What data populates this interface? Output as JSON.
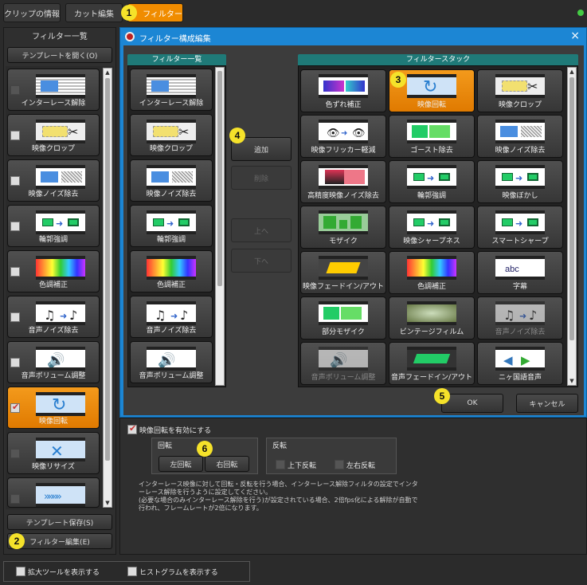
{
  "tabs": [
    "クリップの情報",
    "カット編集",
    "フィルター"
  ],
  "badges": [
    "1",
    "2",
    "3",
    "4",
    "5",
    "6"
  ],
  "left_panel": {
    "title": "フィルター一覧",
    "template_open": "テンプレートを開く(O)",
    "template_save": "テンプレート保存(S)",
    "filter_edit": "フィルター編集(E)",
    "items": [
      {
        "label": "インターレース解除",
        "icon": "interlace"
      },
      {
        "label": "映像クロップ",
        "icon": "crop"
      },
      {
        "label": "映像ノイズ除去",
        "icon": "noise"
      },
      {
        "label": "輪郭強調",
        "icon": "edge"
      },
      {
        "label": "色調補正",
        "icon": "color"
      },
      {
        "label": "音声ノイズ除去",
        "icon": "audio-noise"
      },
      {
        "label": "音声ボリューム調整",
        "icon": "volume"
      },
      {
        "label": "映像回転",
        "icon": "rotate"
      },
      {
        "label": "映像リサイズ",
        "icon": "resize"
      },
      {
        "label": "",
        "icon": "arrows"
      }
    ]
  },
  "dialog": {
    "title": "フィルター構成編集",
    "close": "×",
    "list_title": "フィルター一覧",
    "stack_title": "フィルタースタック",
    "list_items": [
      {
        "label": "インターレース解除",
        "icon": "interlace"
      },
      {
        "label": "映像クロップ",
        "icon": "crop"
      },
      {
        "label": "映像ノイズ除去",
        "icon": "noise"
      },
      {
        "label": "輪郭強調",
        "icon": "edge"
      },
      {
        "label": "色調補正",
        "icon": "color"
      },
      {
        "label": "音声ノイズ除去",
        "icon": "audio-noise"
      },
      {
        "label": "音声ボリューム調整",
        "icon": "volume"
      }
    ],
    "buttons": {
      "add": "追加",
      "delete": "削除",
      "up": "上へ",
      "down": "下へ",
      "ok": "OK",
      "cancel": "キャンセル"
    },
    "stack_items": [
      {
        "label": "色ずれ補正",
        "icon": "colorshift"
      },
      {
        "label": "映像回転",
        "icon": "rotate"
      },
      {
        "label": "映像クロップ",
        "icon": "crop"
      },
      {
        "label": "映像フリッカー軽減",
        "icon": "flicker"
      },
      {
        "label": "ゴースト除去",
        "icon": "ghost"
      },
      {
        "label": "映像ノイズ除去",
        "icon": "noise"
      },
      {
        "label": "高精度映像ノイズ除去",
        "icon": "hq-noise"
      },
      {
        "label": "輪郭強調",
        "icon": "edge"
      },
      {
        "label": "映像ぼかし",
        "icon": "blur"
      },
      {
        "label": "モザイク",
        "icon": "mosaic"
      },
      {
        "label": "映像シャープネス",
        "icon": "edge"
      },
      {
        "label": "スマートシャープ",
        "icon": "edge"
      },
      {
        "label": "映像フェードイン/アウト",
        "icon": "fade"
      },
      {
        "label": "色調補正",
        "icon": "color"
      },
      {
        "label": "字幕",
        "icon": "subtitle"
      },
      {
        "label": "部分モザイク",
        "icon": "partial-mosaic"
      },
      {
        "label": "ビンテージフィルム",
        "icon": "vintage"
      },
      {
        "label": "音声ノイズ除去",
        "icon": "audio-noise"
      },
      {
        "label": "音声ボリューム調整",
        "icon": "volume"
      },
      {
        "label": "音声フェードイン/アウト",
        "icon": "audio-fade"
      },
      {
        "label": "ニヶ国語音声",
        "icon": "bilingual"
      }
    ]
  },
  "settings": {
    "enable": "映像回転を有効にする",
    "rotate_group": "回転",
    "rotate_left": "左回転",
    "rotate_right": "右回転",
    "flip_group": "反転",
    "flip_v": "上下反転",
    "flip_h": "左右反転",
    "desc": "インターレース映像に対して回転・反転を行う場合、インターレース解除フィルタの設定でインターレース解除を行うように設定してください。\n(必要な場合のみインターレース解除を行う)が設定されている場合、2倍fps化による解除が自動で行われ、フレームレートが2倍になります。"
  },
  "footer": {
    "zoom_tool": "拡大ツールを表示する",
    "histogram": "ヒストグラムを表示する"
  }
}
